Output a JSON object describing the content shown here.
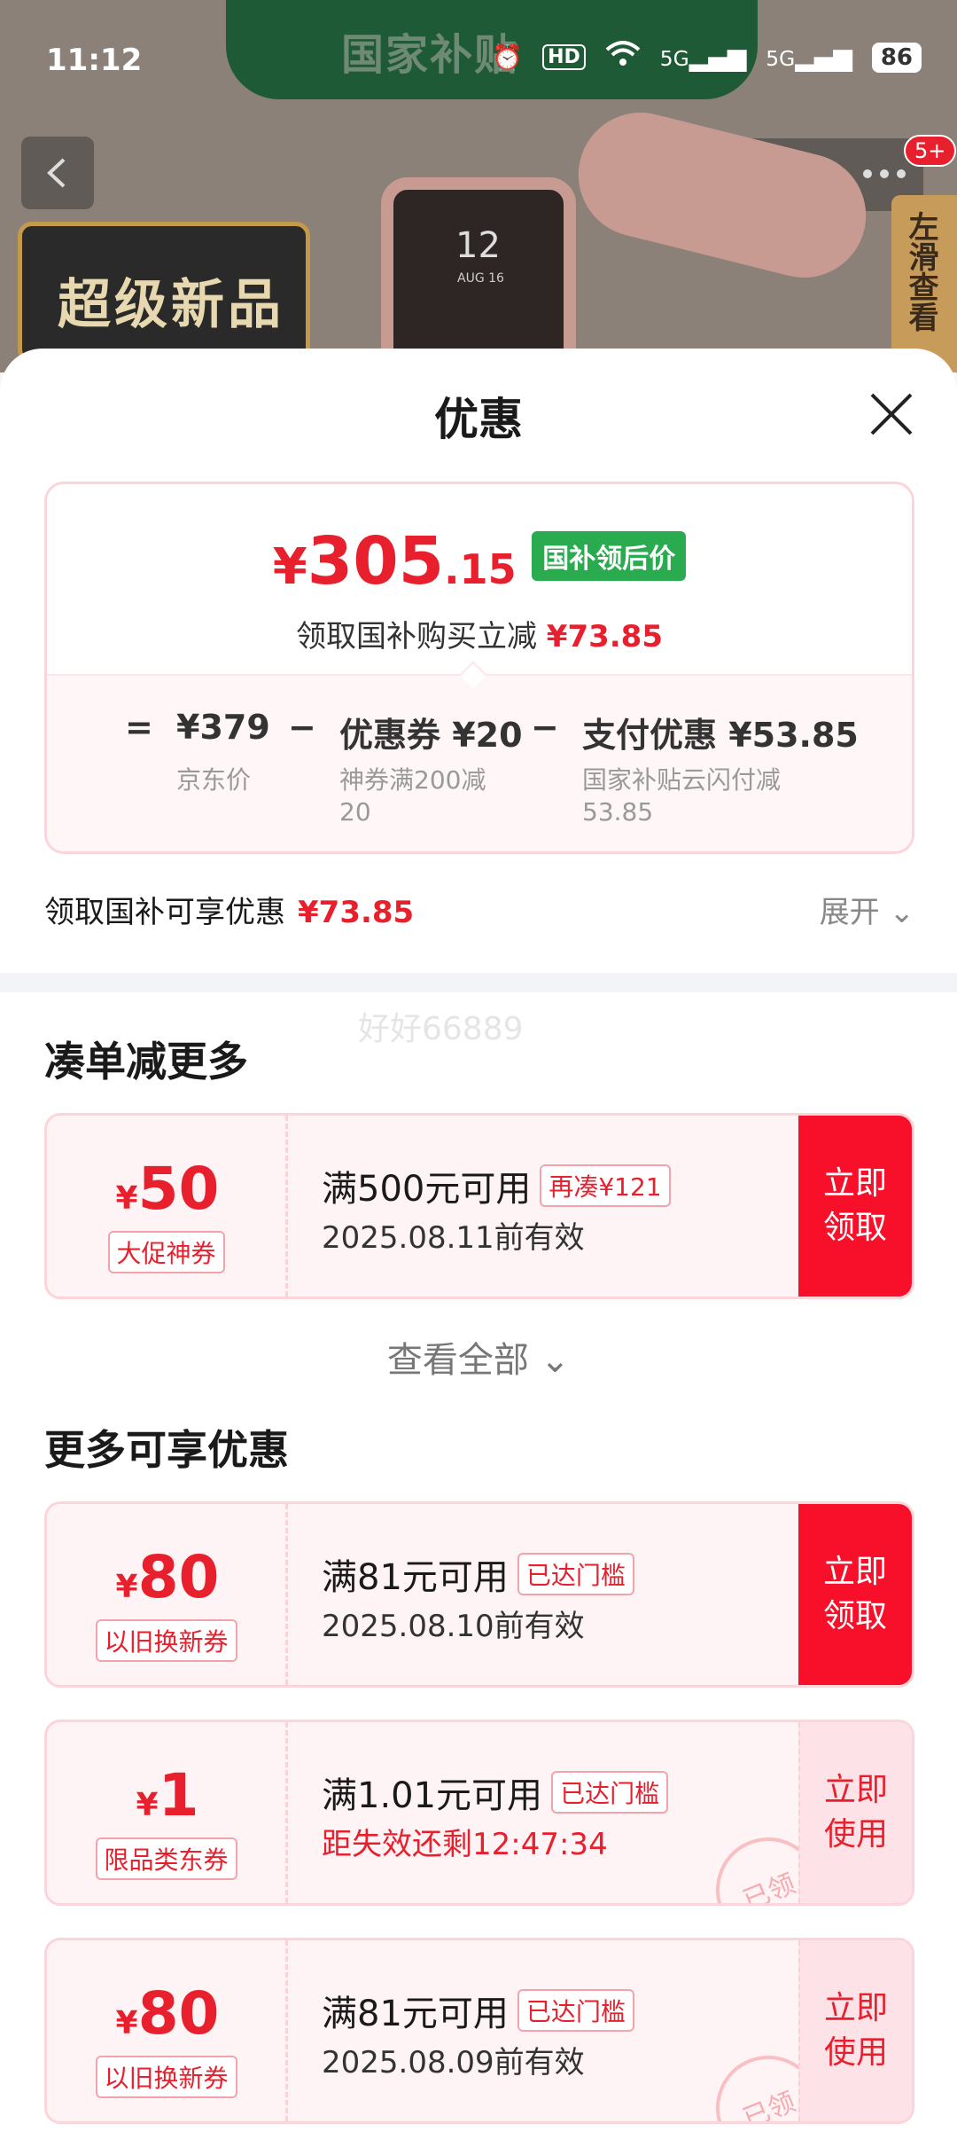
{
  "status_bar": {
    "time": "11:12",
    "battery": "86",
    "signal1": "5G",
    "signal2": "5G",
    "hd": "HD"
  },
  "background": {
    "banner_text": "国家补贴",
    "super_new": "超级新品",
    "watch_time": "12",
    "watch_date": "AUG 16",
    "side_tab": "左滑查看",
    "badge": "5+"
  },
  "sheet": {
    "title": "优惠"
  },
  "price_card": {
    "currency": "¥",
    "price_int": "305",
    "price_dec": ".15",
    "price_tag": "国补领后价",
    "sub_text": "领取国补购买立减",
    "sub_amount": "¥73.85",
    "formula": [
      {
        "op": "=",
        "value": "¥379",
        "note": "京东价"
      },
      {
        "op": "−",
        "value": "优惠券 ¥20",
        "note": "神券满200减\n20"
      },
      {
        "op": "−",
        "value": "支付优惠 ¥53.85",
        "note": "国家补贴云闪付减\n53.85"
      }
    ]
  },
  "benefit_row": {
    "text": "领取国补可享优惠",
    "amount": "¥73.85",
    "expand": "展开"
  },
  "watermark": "好好66889",
  "sections": {
    "bundle_title": "凑单减更多",
    "more_title": "更多可享优惠",
    "view_all": "查看全部"
  },
  "coupons": [
    {
      "currency": "¥",
      "amount": "50",
      "label": "大促神券",
      "condition": "满500元可用",
      "tag": "再凑¥121",
      "validity": "2025.08.11前有效",
      "action": "立即\n领取"
    },
    {
      "currency": "¥",
      "amount": "80",
      "label": "以旧换新券",
      "condition": "满81元可用",
      "tag": "已达门槛",
      "validity": "2025.08.10前有效",
      "action": "立即\n领取"
    },
    {
      "currency": "¥",
      "amount": "1",
      "label": "限品类东券",
      "condition": "满1.01元可用",
      "tag": "已达门槛",
      "validity": "距失效还剩12:47:34",
      "action": "立即\n使用",
      "stamp": "已领"
    },
    {
      "currency": "¥",
      "amount": "80",
      "label": "以旧换新券",
      "condition": "满81元可用",
      "tag": "已达门槛",
      "validity": "2025.08.09前有效",
      "action": "立即\n使用",
      "stamp": "已领"
    }
  ]
}
